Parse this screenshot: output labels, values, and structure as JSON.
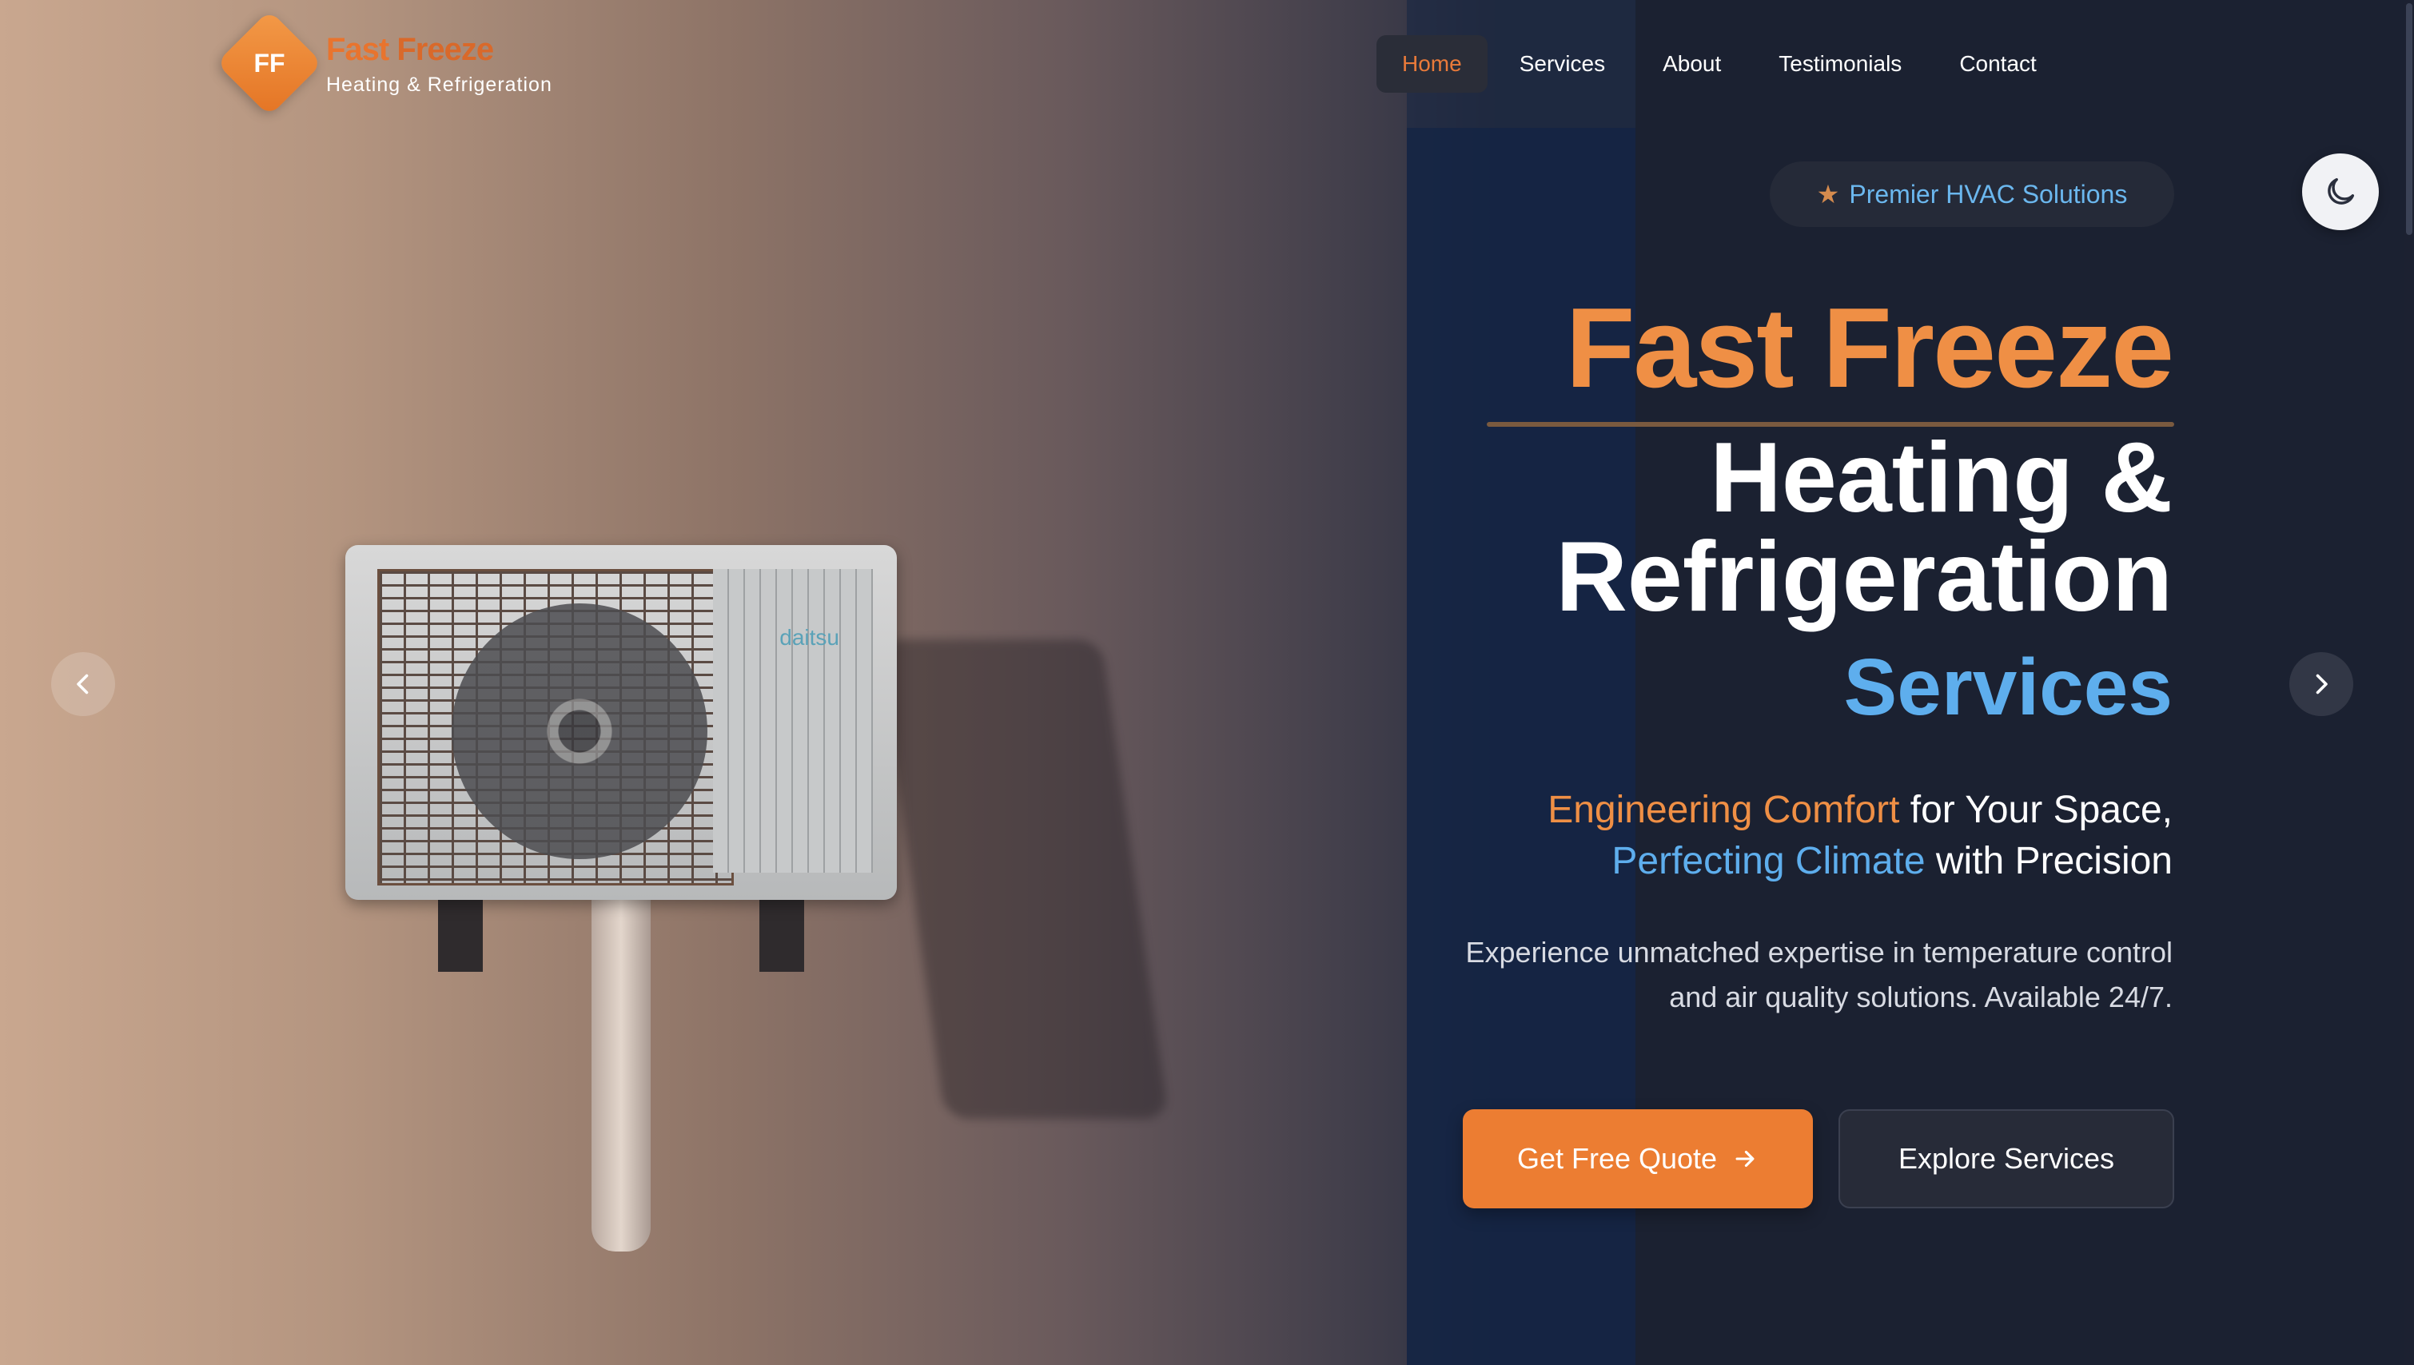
{
  "brand": {
    "initials": "FF",
    "name_part1": "Fast",
    "name_part2": "Freeze",
    "subtitle": "Heating & Refrigeration"
  },
  "nav": {
    "items": [
      {
        "label": "Home",
        "active": true
      },
      {
        "label": "Services",
        "active": false
      },
      {
        "label": "About",
        "active": false
      },
      {
        "label": "Testimonials",
        "active": false
      },
      {
        "label": "Contact",
        "active": false
      }
    ]
  },
  "theme_toggle": {
    "icon": "moon-icon"
  },
  "hero": {
    "badge_icon": "★",
    "badge_text": "Premier HVAC Solutions",
    "title_line1": "Fast Freeze",
    "title_line2": "Heating &",
    "title_line3": "Refrigeration",
    "title_line4": "Services",
    "tagline": {
      "highlight1": "Engineering Comfort",
      "rest1": " for Your Space,",
      "highlight2": "Perfecting Climate",
      "rest2": " with Precision"
    },
    "description_line1": "Experience unmatched expertise in temperature control",
    "description_line2": "and air quality solutions. Available 24/7.",
    "image_brand_text": "daitsu",
    "cta_primary": "Get Free Quote",
    "cta_secondary": "Explore Services"
  },
  "carousel": {
    "prev_icon": "chevron-left-icon",
    "next_icon": "chevron-right-icon"
  },
  "colors": {
    "accent_orange": "#ec7d32",
    "accent_blue": "#5eaeed",
    "dark_bg": "#1b2131"
  }
}
